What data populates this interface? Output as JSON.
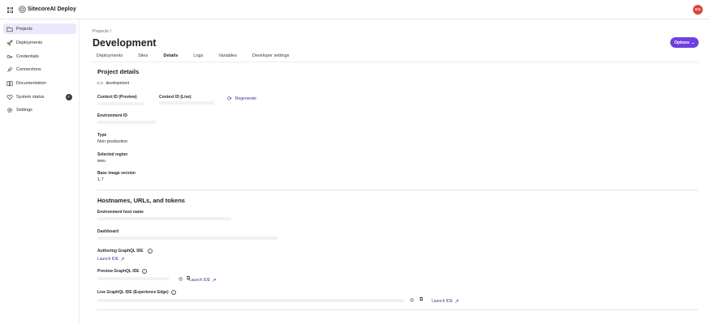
{
  "app": {
    "title": "SitecoreAI Deploy",
    "avatar_initials": "KS",
    "avatar_color": "#d9473a"
  },
  "sidebar": {
    "items": [
      {
        "label": "Projects",
        "icon": "folder-icon",
        "active": true
      },
      {
        "label": "Deployments",
        "icon": "rocket-icon"
      },
      {
        "label": "Credentials",
        "icon": "key-icon"
      },
      {
        "label": "Connections",
        "icon": "plug-icon"
      },
      {
        "label": "Documentation",
        "icon": "book-icon"
      },
      {
        "label": "System status",
        "icon": "heart-icon",
        "status": "check-circle-icon"
      },
      {
        "label": "Settings",
        "icon": "gear-icon"
      }
    ]
  },
  "header": {
    "breadcrumb": "Projects  /",
    "title": "Development",
    "options_label": "Options"
  },
  "tabs": [
    {
      "label": "Deployments"
    },
    {
      "label": "Sites"
    },
    {
      "label": "Details",
      "active": true
    },
    {
      "label": "Logs"
    },
    {
      "label": "Variables"
    },
    {
      "label": "Developer settings"
    }
  ],
  "details": {
    "title": "Project details",
    "environment_name": "development",
    "context_preview_label": "Context ID (Preview)",
    "context_live_label": "Context ID (Live)",
    "regenerate_label": "Regenerate",
    "environment_id_label": "Environment ID",
    "type_label": "Type",
    "type_value": "Non production",
    "region_label": "Selected region",
    "region_value": "weu",
    "base_image_label": "Base image version",
    "base_image_value": "1.7"
  },
  "hosts": {
    "title": "Hostnames, URLs, and tokens",
    "env_host_label": "Environment host name",
    "dashboard_label": "Dashboard",
    "authoring_label": "Authoring GraphQL IDE",
    "preview_label": "Preview GraphQL IDE",
    "live_label": "Live GraphQL IDE (Experience Edge)",
    "launch_label": "Launch IDE"
  },
  "colors": {
    "accent": "#6e3fe0",
    "link": "#3a3a9a",
    "active_nav_bg": "#ece8fb"
  }
}
